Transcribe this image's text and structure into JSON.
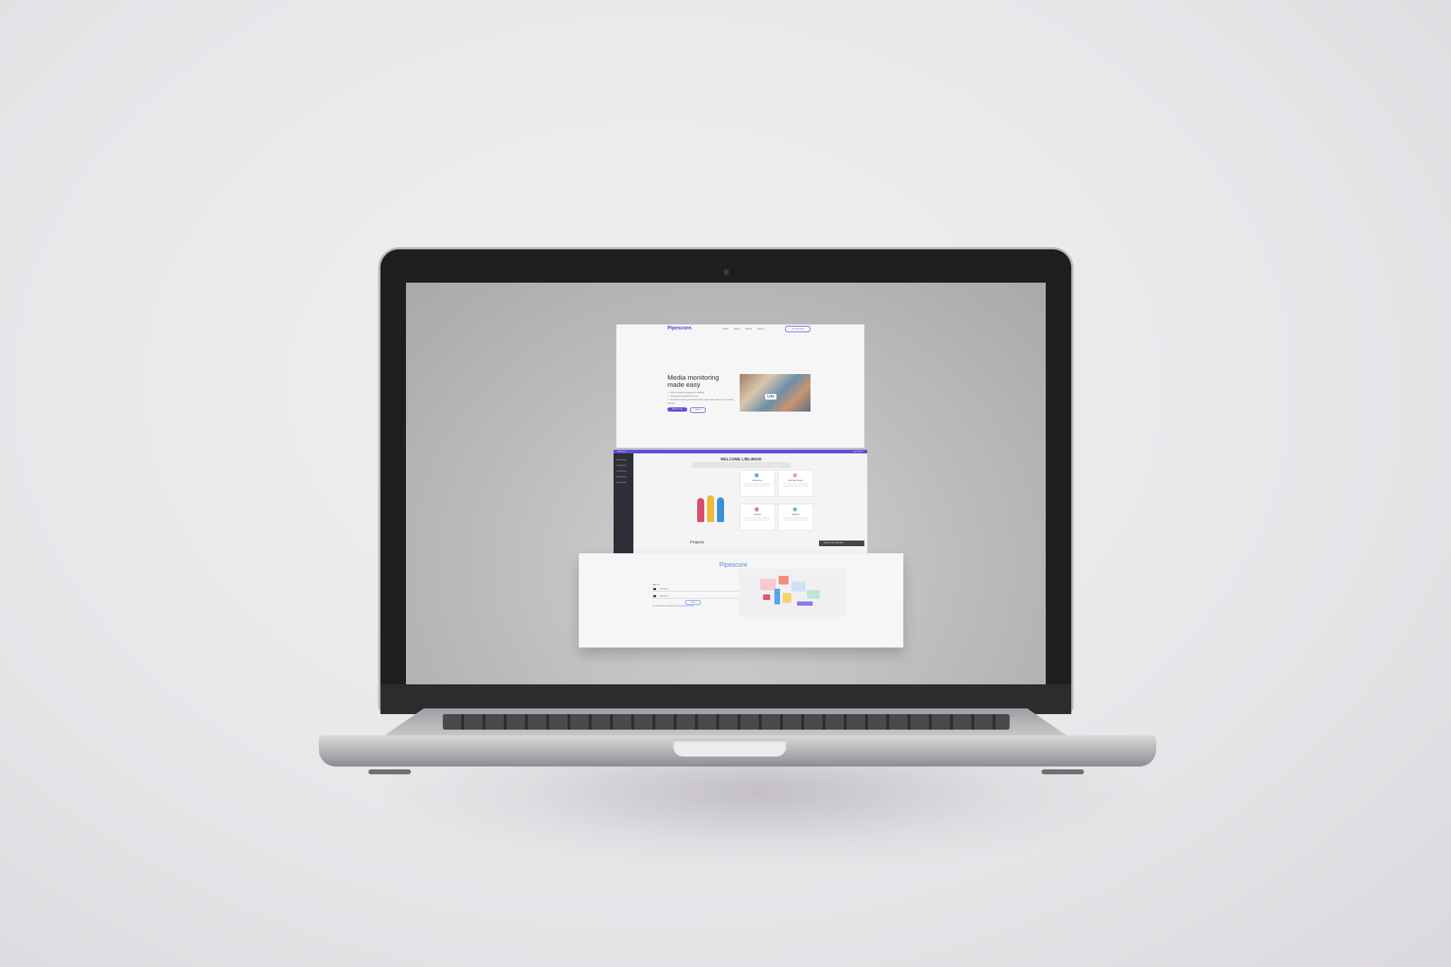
{
  "device": "laptop",
  "landing": {
    "brand": "Pipescore.",
    "nav": [
      "Home",
      "About",
      "Pricing",
      "Sign In"
    ],
    "nav_button": "Try it for free",
    "headline": "Media monitoring made easy",
    "bullets": [
      "Online reputation management, redefined",
      "Tracking any competitors from any",
      "Get instant results & performance across social, news, blogs, forums, reviews, and more"
    ],
    "primary_button": "Start for free",
    "secondary_button": "Demo",
    "photo_badge": "Like"
  },
  "dashboard": {
    "topbar_left": "Pipescore",
    "topbar_right": "My Projects",
    "welcome": "WELCOME LIBLIMANI",
    "cards": [
      {
        "title": "Monitoring",
        "icon": "monitor-icon",
        "color": "#6fa8e6"
      },
      {
        "title": "Alert Bas Project",
        "icon": "alert-icon",
        "color": "#e8a5a0"
      },
      {
        "title": "Analysis",
        "icon": "analysis-icon",
        "color": "#e07b8a"
      },
      {
        "title": "Statistics",
        "icon": "stats-icon",
        "color": "#6bc4a6"
      }
    ],
    "projects_label": "Projects",
    "action_bar": "CREATE NEW PROJECT"
  },
  "login": {
    "brand": "Pipescore",
    "label": "Sign In",
    "email_placeholder": "Username",
    "password_placeholder": "Password",
    "button": "Login",
    "footer_text": "You don't have an account yet?",
    "footer_link": "Create an account"
  },
  "colors": {
    "brand_purple": "#5b4fdc",
    "brand_blue": "#4a8fe0",
    "sidebar_dark": "#2e2f36"
  }
}
